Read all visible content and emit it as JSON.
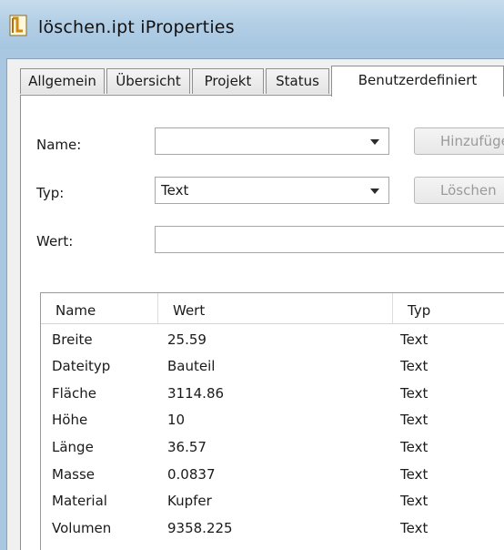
{
  "window": {
    "title": "löschen.ipt iProperties"
  },
  "tabs": [
    {
      "label": "Allgemein"
    },
    {
      "label": "Übersicht"
    },
    {
      "label": "Projekt"
    },
    {
      "label": "Status"
    },
    {
      "label": "Benutzerdefiniert",
      "active": true
    }
  ],
  "form": {
    "name_label": "Name:",
    "name_value": "",
    "typ_label": "Typ:",
    "typ_value": "Text",
    "wert_label": "Wert:",
    "wert_value": "",
    "add_button": "Hinzufügen",
    "delete_button": "Löschen"
  },
  "list": {
    "columns": [
      "Name",
      "Wert",
      "Typ"
    ],
    "rows": [
      [
        "Breite",
        "25.59",
        "Text"
      ],
      [
        "Dateityp",
        "Bauteil",
        "Text"
      ],
      [
        "Fläche",
        "3114.86",
        "Text"
      ],
      [
        "Höhe",
        "10",
        "Text"
      ],
      [
        "Länge",
        "36.57",
        "Text"
      ],
      [
        "Masse",
        "0.0837",
        "Text"
      ],
      [
        "Material",
        "Kupfer",
        "Text"
      ],
      [
        "Volumen",
        "9358.225",
        "Text"
      ]
    ]
  },
  "colors": {
    "titlebar": "#b3cfe6",
    "frame": "#a9c7e1",
    "panel": "#ffffff",
    "disabled_text": "#9a9a9a"
  },
  "icons": {
    "app": "inventor-document-icon",
    "dropdown": "dropdown-arrow-icon"
  }
}
